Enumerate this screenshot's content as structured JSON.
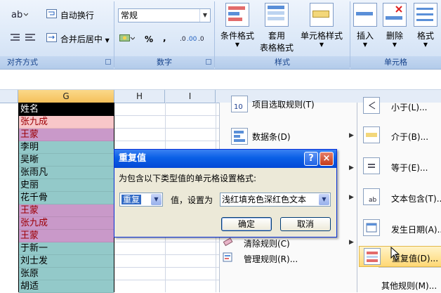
{
  "ribbon": {
    "alignment": {
      "wrap_text": "自动换行",
      "merge_center": "合并后居中",
      "group_label": "对齐方式"
    },
    "number": {
      "format_value": "常规",
      "percent_symbol": "%",
      "comma_symbol": ",",
      "group_label": "数字"
    },
    "styles": {
      "conditional_formatting": "条件格式",
      "format_as_table_line1": "套用",
      "format_as_table_line2": "表格格式",
      "cell_styles": "单元格样式",
      "group_label": "样式"
    },
    "cells": {
      "insert": "插入",
      "delete": "删除",
      "format": "格式",
      "group_label": "单元格"
    }
  },
  "sheet": {
    "columns": [
      "G",
      "H",
      "I"
    ],
    "cells": [
      {
        "text": "姓名",
        "style": "hdr"
      },
      {
        "text": "张九成",
        "style": "red"
      },
      {
        "text": "王蒙",
        "style": "pur"
      },
      {
        "text": "李明",
        "style": "teal"
      },
      {
        "text": "吴晰",
        "style": "teal"
      },
      {
        "text": "张雨凡",
        "style": "teal"
      },
      {
        "text": "史丽",
        "style": "teal"
      },
      {
        "text": "花千骨",
        "style": "teal"
      },
      {
        "text": "王蒙",
        "style": "pur"
      },
      {
        "text": "张九成",
        "style": "pur"
      },
      {
        "text": "王蒙",
        "style": "pur"
      },
      {
        "text": "于新一",
        "style": "teal"
      },
      {
        "text": "刘士发",
        "style": "teal"
      },
      {
        "text": "张原",
        "style": "teal"
      },
      {
        "text": "胡适",
        "style": "teal"
      }
    ]
  },
  "menu_main": {
    "item_top_rules": "项目选取规则(T)",
    "item_data_bars": "数据条(D)",
    "item_clear_rules": "清除规则(C)",
    "item_manage_rules": "管理规则(R)..."
  },
  "menu_sub": {
    "less_than": "小于(L)...",
    "between": "介于(B)...",
    "equal_to": "等于(E)...",
    "text_contains": "文本包含(T)...",
    "date_occurring": "发生日期(A)...",
    "duplicate_values": "重复值(D)...",
    "more_rules": "其他规则(M)..."
  },
  "dialog": {
    "title": "重复值",
    "prompt": "为包含以下类型值的单元格设置格式:",
    "type_value": "重复",
    "mid_label": "值，设置为",
    "format_value": "浅红填充色深红色文本",
    "ok": "确定",
    "cancel": "取消",
    "help_symbol": "?",
    "close_symbol": "×"
  },
  "colors": {
    "ribbon_text": "#15428b",
    "highlight_red_fill": "#f8c7c9",
    "highlight_red_text": "#9c0006",
    "purple_fill": "#c999c9",
    "teal_fill": "#93c9c9",
    "dialog_title_bar": "#0a5fe6"
  }
}
